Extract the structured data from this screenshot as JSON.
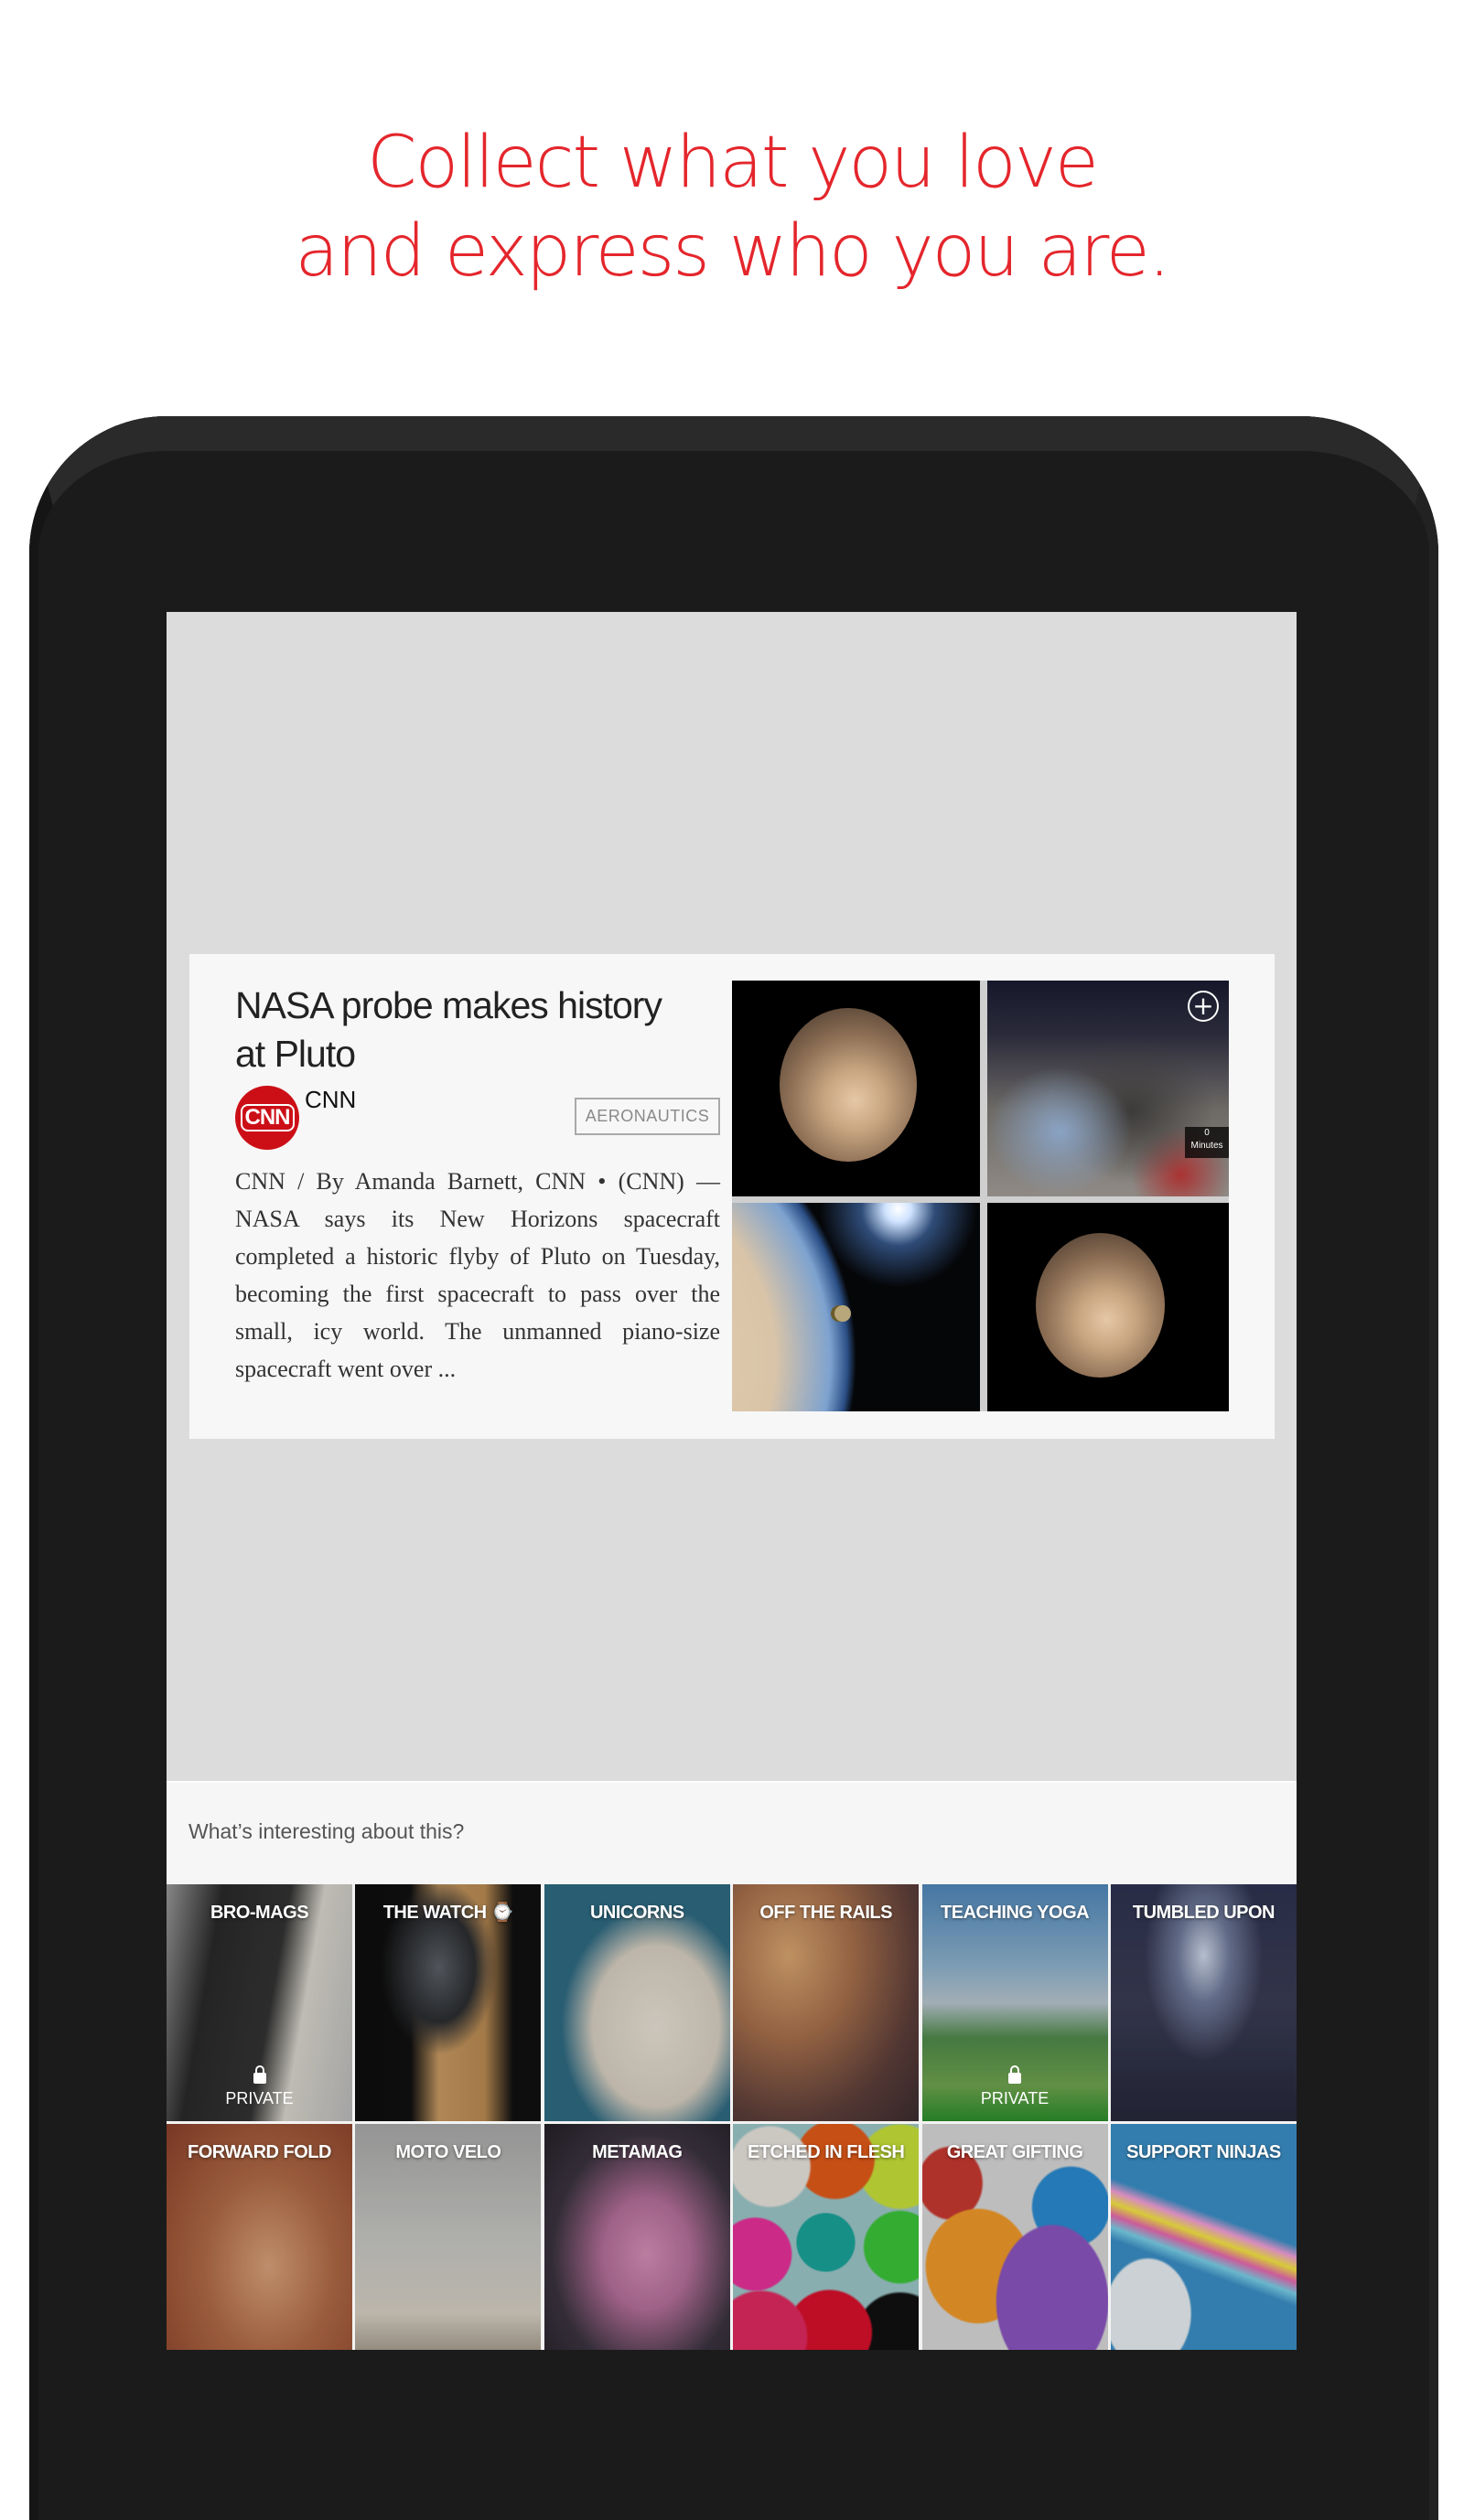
{
  "headline": {
    "line1": "Collect what you love",
    "line2": "and express who you are."
  },
  "colors": {
    "accent": "#e4262c",
    "tablet_frame": "#1b1b1b",
    "screen_background": "#dcdcdc",
    "card_background": "#f7f7f7",
    "source_logo": "#cc0f17"
  },
  "card": {
    "title": "NASA probe makes history at Pluto",
    "source": {
      "logo_text": "CNN",
      "name": "CNN"
    },
    "tag": "AERONAUTICS",
    "excerpt": "CNN / By Amanda Barnett, CNN • (CNN) — NASA says its New Horizons spacecraft completed a historic flyby of Pluto on Tuesday, becoming the first spacecraft to pass over the small, icy world. The unmanned piano-size spacecraft went over ...",
    "images": [
      {
        "subject": "Pluto"
      },
      {
        "subject": "Celebrating crowd",
        "timer_value": "0",
        "timer_label": "Minutes"
      },
      {
        "subject": "New Horizons spacecraft over Earth"
      },
      {
        "subject": "Pluto"
      }
    ],
    "add_icon": "plus-circle-icon",
    "add_glyph": "+"
  },
  "prompt": {
    "text": "What’s interesting about this?"
  },
  "collections": [
    {
      "label": "BRO-MAGS",
      "private": true,
      "bg": "bro-mags"
    },
    {
      "label": "THE WATCH ⌚",
      "private": false,
      "bg": "the-watch"
    },
    {
      "label": "UNICORNS",
      "private": false,
      "bg": "unicorns"
    },
    {
      "label": "OFF THE RAILS",
      "private": false,
      "bg": "off-the-rails"
    },
    {
      "label": "TEACHING YOGA",
      "private": true,
      "bg": "teaching-yoga"
    },
    {
      "label": "TUMBLED UPON",
      "private": false,
      "bg": "tumbled-upon"
    },
    {
      "label": "FORWARD FOLD",
      "private": false,
      "bg": "forward-fold"
    },
    {
      "label": "MOTO VELO",
      "private": false,
      "bg": "moto-velo"
    },
    {
      "label": "METAMAG",
      "private": false,
      "bg": "metamag"
    },
    {
      "label": "ETCHED IN FLESH",
      "private": false,
      "bg": "etched-in-flesh"
    },
    {
      "label": "GREAT GIFTING",
      "private": false,
      "bg": "great-gifting"
    },
    {
      "label": "SUPPORT NINJAS",
      "private": false,
      "bg": "support-ninjas"
    }
  ],
  "private_label": "PRIVATE"
}
